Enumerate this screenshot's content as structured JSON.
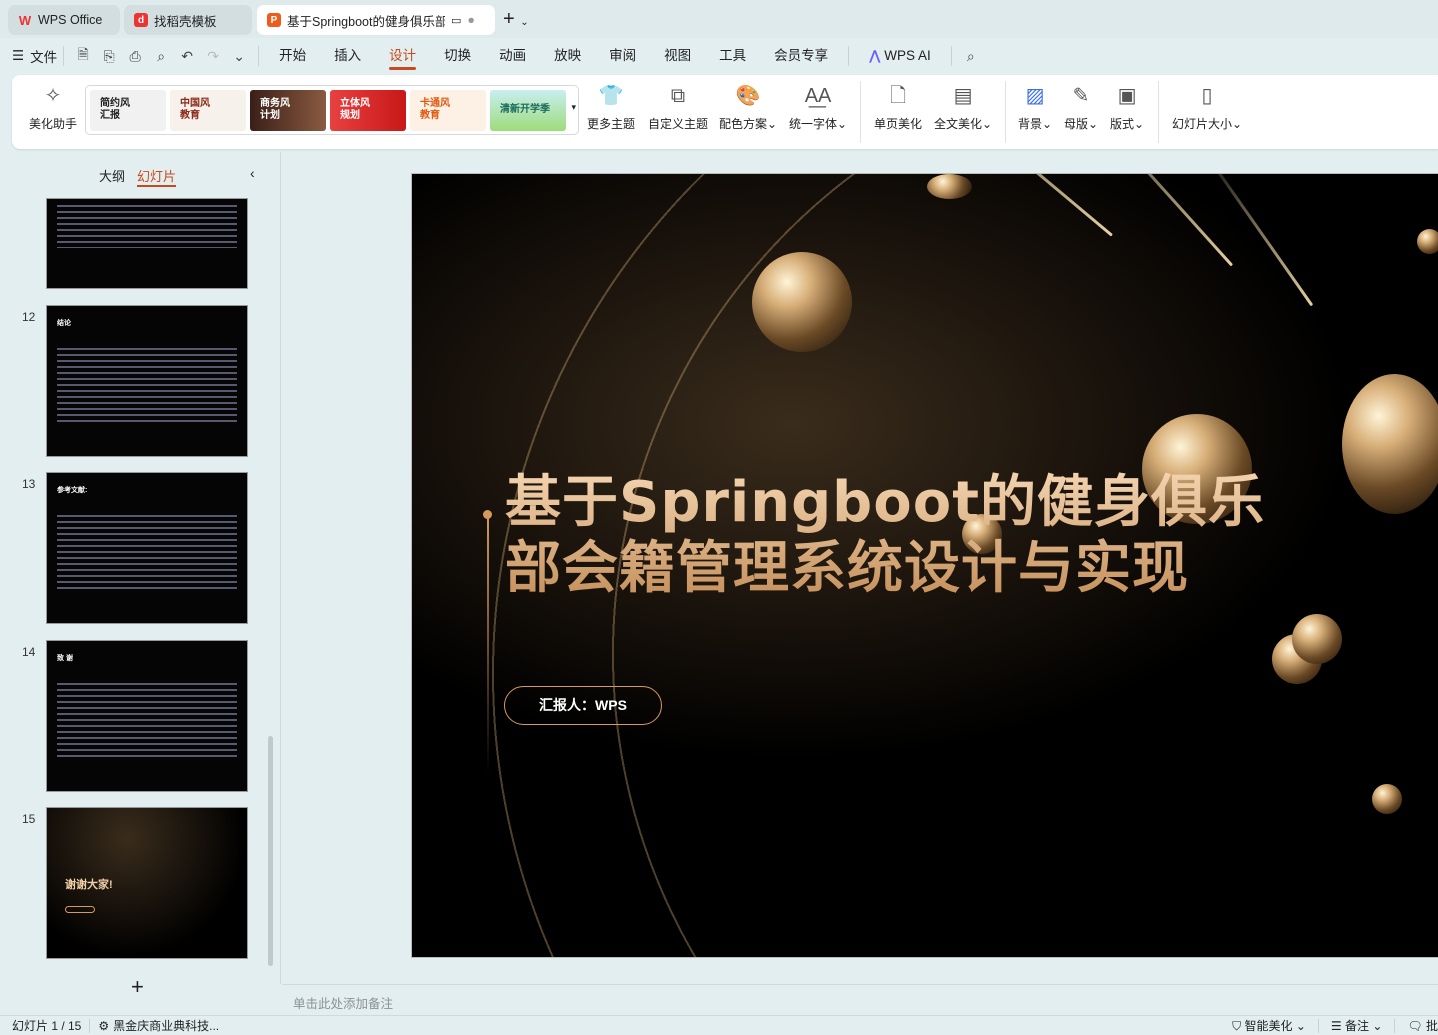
{
  "tabs": [
    {
      "label": "WPS Office",
      "icon": "wps-logo-icon",
      "color": "#e33"
    },
    {
      "label": "找稻壳模板",
      "icon": "docer-icon",
      "color": "#e33"
    },
    {
      "label": "基于Springboot的健身俱乐部",
      "icon": "presentation-icon",
      "color": "#f05a1a"
    }
  ],
  "menu": {
    "file": "文件",
    "items": [
      "开始",
      "插入",
      "设计",
      "切换",
      "动画",
      "放映",
      "审阅",
      "视图",
      "工具",
      "会员专享"
    ],
    "active": "设计",
    "ai": "WPS AI"
  },
  "ribbon": {
    "assistant": "美化助手",
    "themes": [
      "简约风\n汇报",
      "中国风\n教育",
      "商务风\n计划",
      "立体风\n规划",
      "卡通风\n教育",
      "清新开学季"
    ],
    "buttons": [
      "更多主题",
      "自定义主题",
      "配色方案",
      "统一字体",
      "单页美化",
      "全文美化",
      "背景",
      "母版",
      "版式",
      "幻灯片大小"
    ]
  },
  "left": {
    "tabs": [
      "大纲",
      "幻灯片"
    ],
    "active": "幻灯片",
    "slides": [
      {
        "num": "",
        "title": ""
      },
      {
        "num": "12",
        "title": "结论"
      },
      {
        "num": "13",
        "title": "参考文献:"
      },
      {
        "num": "14",
        "title": "致 谢"
      },
      {
        "num": "15",
        "title": "谢谢大家!"
      }
    ],
    "add": "+"
  },
  "slide": {
    "title_line1": "基于Springboot的健身俱乐",
    "title_line2": "部会籍管理系统设计与实现",
    "reporter": "汇报人：WPS",
    "accent": "#d79a5c"
  },
  "notes_placeholder": "单击此处添加备注",
  "status": {
    "slide_count": "幻灯片 1 / 15",
    "theme": "黑金庆商业典科技...",
    "smart": "智能美化",
    "notes": "备注",
    "comment": "批"
  }
}
